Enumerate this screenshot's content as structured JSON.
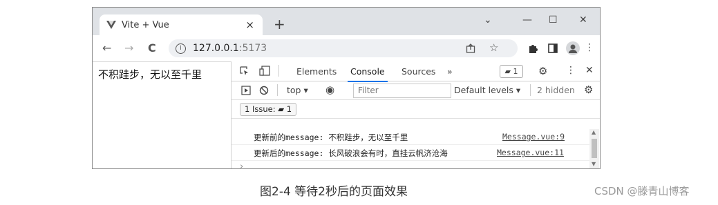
{
  "browser": {
    "tab_title": "Vite + Vue",
    "tab_close": "×",
    "new_tab": "+",
    "minimize": "—",
    "maximize": "☐",
    "close": "✕",
    "chevron": "⌄",
    "back": "←",
    "forward": "→",
    "reload": "C",
    "url_host": "127.0.0.1",
    "url_port": ":5173"
  },
  "page": {
    "text": "不积跬步，无以至千里"
  },
  "devtools": {
    "tabs": [
      "Elements",
      "Console",
      "Sources",
      "»"
    ],
    "active_tab": "Console",
    "issue_count": "1",
    "context": "top ▾",
    "filter_placeholder": "Filter",
    "levels": "Default levels ▾",
    "hidden": "2 hidden",
    "issues_label": "1 Issue:",
    "issues_count": "1",
    "logs": [
      {
        "message": "更新前的message: 不积跬步，无以至千里",
        "source": "Message.vue:9"
      },
      {
        "message": "更新后的message: 长风破浪会有时，直挂云帆济沧海",
        "source": "Message.vue:11"
      }
    ],
    "prompt": "›"
  },
  "caption": "图2-4   等待2秒后的页面效果",
  "watermark": "CSDN @滕青山博客"
}
